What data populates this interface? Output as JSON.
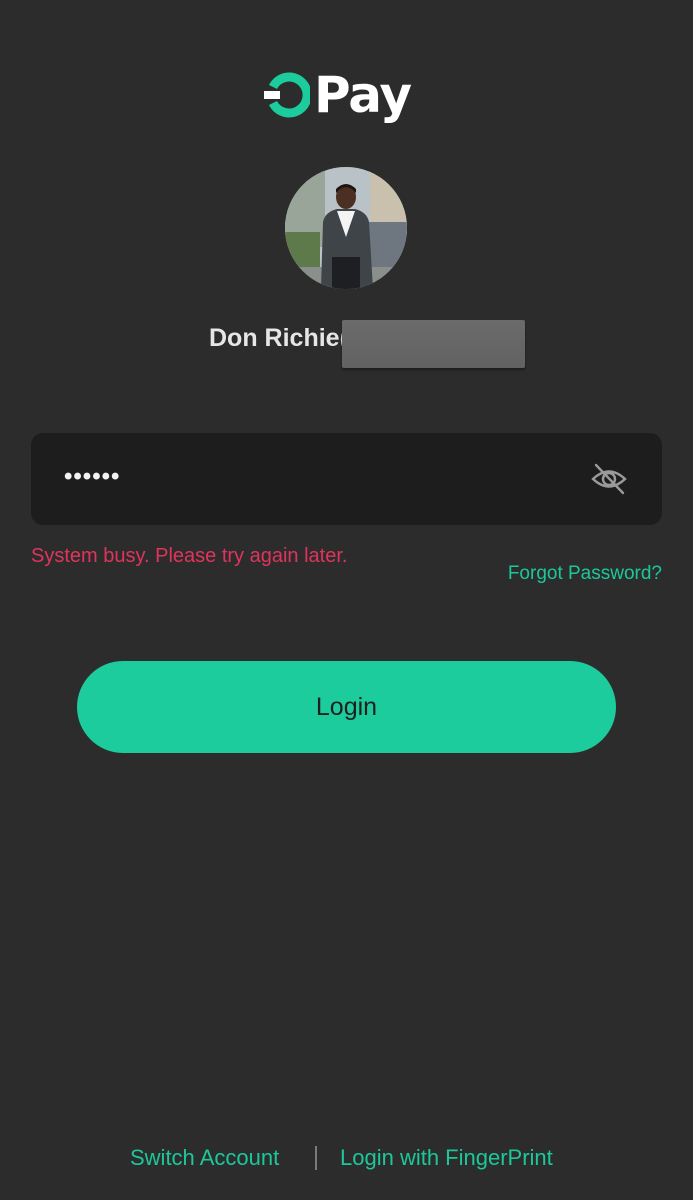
{
  "brand": {
    "name": "Pay",
    "accent_color": "#1ccc9c",
    "logo_icon": "opay-ring-icon"
  },
  "user": {
    "name": "Don Richie(",
    "avatar_icon": "user-avatar"
  },
  "password_field": {
    "value": "••••••",
    "visibility_icon": "eye-off-icon"
  },
  "error": {
    "message": "System busy. Please try again later.",
    "color": "#e0345c"
  },
  "links": {
    "forgot_password": "Forgot Password?"
  },
  "login_button": {
    "label": "Login"
  },
  "footer": {
    "switch_account": "Switch Account",
    "fingerprint_login": "Login with FingerPrint"
  }
}
